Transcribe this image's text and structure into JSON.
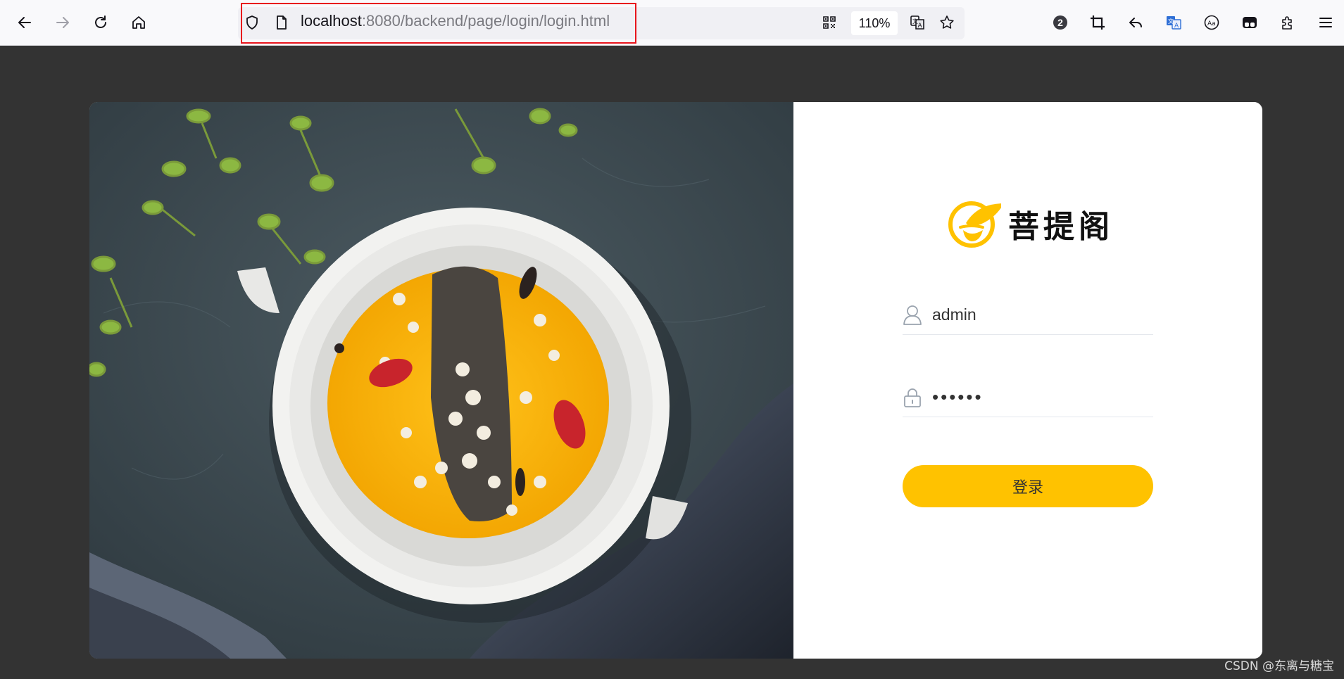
{
  "browser": {
    "url_host": "localhost",
    "url_rest": ":8080/backend/page/login/login.html",
    "zoom": "110%",
    "notification_count": "2"
  },
  "login": {
    "brand_name": "菩提阁",
    "username_value": "admin",
    "password_value": "••••••",
    "login_label": "登录"
  },
  "watermark": "CSDN @东离与糖宝",
  "colors": {
    "page_bg": "#333333",
    "accent": "#ffc200",
    "url_highlight": "#e8141c"
  },
  "icons": {
    "back": "arrow-left-icon",
    "forward": "arrow-right-icon",
    "reload": "reload-icon",
    "home": "home-icon",
    "shield": "shield-icon",
    "page": "page-icon",
    "qr": "qr-code-icon",
    "translate": "translate-icon",
    "star": "star-icon",
    "user": "user-icon",
    "lock": "lock-icon"
  }
}
